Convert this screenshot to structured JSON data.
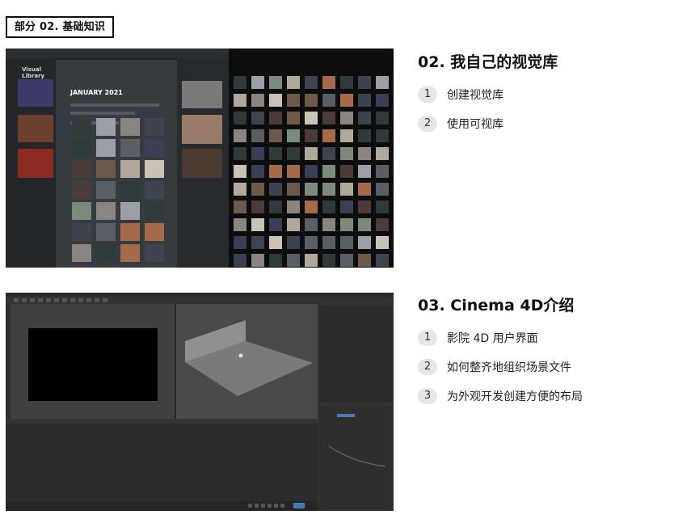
{
  "part_label": "部分 02. 基础知识",
  "sections": [
    {
      "title": "02. 我自己的视觉库",
      "items": [
        {
          "num": "1",
          "text": "创建视觉库"
        },
        {
          "num": "2",
          "text": "使用可视库"
        }
      ]
    },
    {
      "title": "03. Cinema 4D介绍",
      "items": [
        {
          "num": "1",
          "text": "影院 4D 用户界面"
        },
        {
          "num": "2",
          "text": "如何整齐地组织场景文件"
        },
        {
          "num": "3",
          "text": "为外观开发创建方便的布局"
        }
      ]
    }
  ],
  "screenshot1": {
    "app_title": "Visual Library",
    "month_heading": "JANUARY 2021"
  }
}
